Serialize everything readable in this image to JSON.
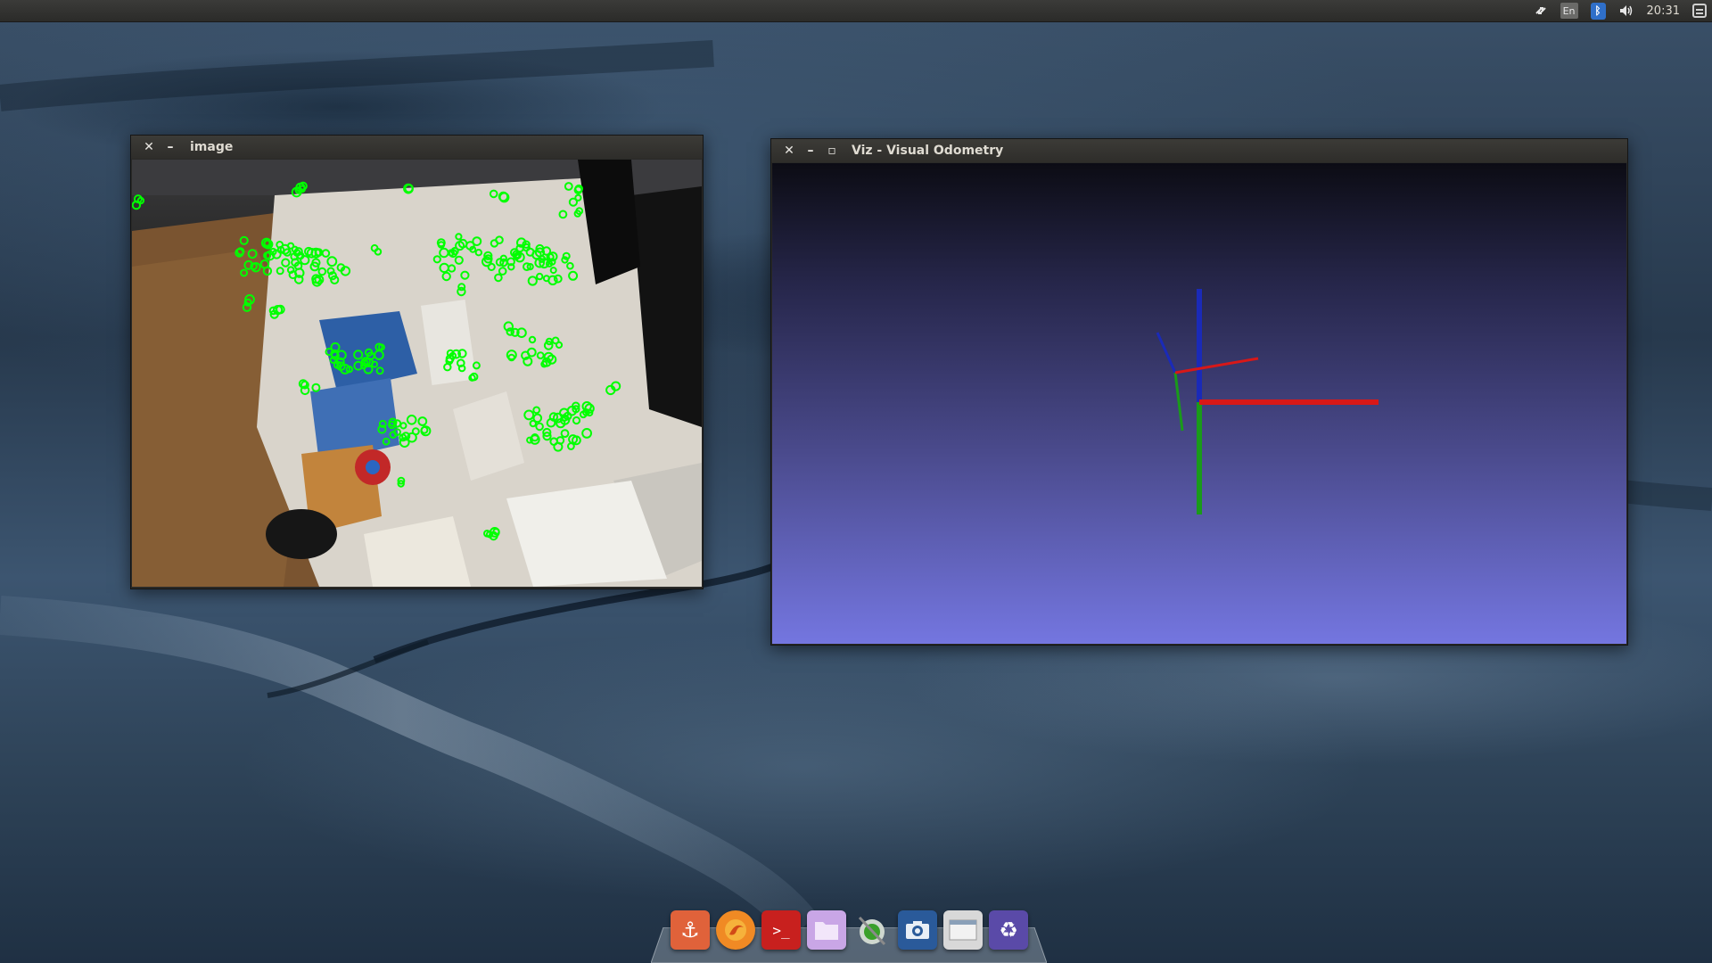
{
  "top_panel": {
    "keyboard_layout": "En",
    "bluetooth_symbol": "ᛒ",
    "time": "20:31",
    "icons": [
      "network-transfer-icon",
      "keyboard-layout-icon",
      "bluetooth-icon",
      "volume-icon",
      "session-menu-icon"
    ]
  },
  "windows": {
    "image": {
      "title": "image",
      "close_glyph": "✕",
      "minimize_glyph": "–"
    },
    "viz": {
      "title": "Viz - Visual Odometry",
      "close_glyph": "✕",
      "minimize_glyph": "–",
      "maximize_glyph": "▫"
    }
  },
  "viz_scene": {
    "background": [
      "#0c0c14",
      "#7476e0"
    ],
    "axis_colors": {
      "x": "#d81818",
      "y": "#1a9a1a",
      "z": "#1a2ab8"
    }
  },
  "feature_color": "#00ff00",
  "dock": {
    "items": [
      {
        "name": "anchor-icon",
        "glyph": "⚓",
        "color": "#e0623a"
      },
      {
        "name": "firefox-icon",
        "glyph": "",
        "color": "#f08a24"
      },
      {
        "name": "terminal-icon",
        "glyph": ">_",
        "color": "#c8201e"
      },
      {
        "name": "files-icon",
        "glyph": "",
        "color": "#c9a6e6"
      },
      {
        "name": "system-settings-icon",
        "glyph": "",
        "color": "#3a3a3a"
      },
      {
        "name": "camera-icon",
        "glyph": "📷",
        "color": "#2a5a9a"
      },
      {
        "name": "window-icon",
        "glyph": "",
        "color": "#d8d8d8"
      },
      {
        "name": "trash-icon",
        "glyph": "♻",
        "color": "#5a4aa8"
      }
    ]
  }
}
